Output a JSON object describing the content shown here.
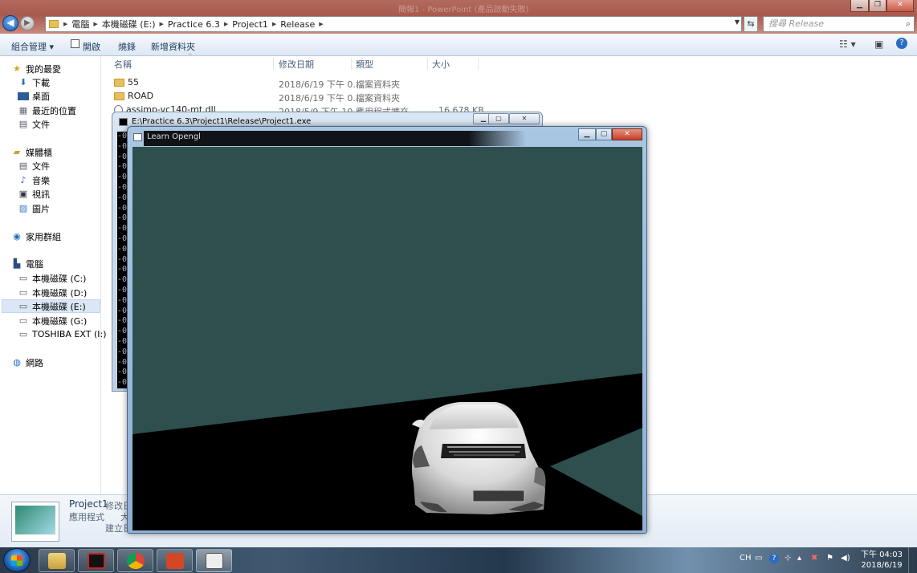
{
  "explorer": {
    "ghost_title": "簡報1 - PowerPoint (產品啟動失敗)",
    "address": [
      "電腦",
      "本機磁碟 (E:)",
      "Practice 6.3",
      "Project1",
      "Release"
    ],
    "search_placeholder": "搜尋 Release",
    "toolbar": {
      "organize": "組合管理 ▾",
      "open": "開啟",
      "burn": "燒錄",
      "new_folder": "新增資料夾"
    },
    "nav": {
      "favorites": "我的最愛",
      "downloads": "下載",
      "desktop": "桌面",
      "recent": "最近的位置",
      "docs_fav": "文件",
      "libraries": "媒體櫃",
      "lib_docs": "文件",
      "lib_music": "音樂",
      "lib_video": "視訊",
      "lib_pictures": "圖片",
      "homegroup": "家用群組",
      "computer": "電腦",
      "drive_c": "本機磁碟 (C:)",
      "drive_d": "本機磁碟 (D:)",
      "drive_e": "本機磁碟 (E:)",
      "drive_g": "本機磁碟 (G:)",
      "drive_i": "TOSHIBA EXT (I:)",
      "network": "網路"
    },
    "columns": {
      "name": "名稱",
      "date": "修改日期",
      "type": "類型",
      "size": "大小"
    },
    "files": [
      {
        "name": "55",
        "date": "2018/6/19 下午 0...",
        "type": "檔案資料夾",
        "size": ""
      },
      {
        "name": "ROAD",
        "date": "2018/6/19 下午 0...",
        "type": "檔案資料夾",
        "size": ""
      },
      {
        "name": "assimp-vc140-mt.dll",
        "date": "2018/5/9 下午 10...",
        "type": "應用程式擴充",
        "size": "16,678 KB"
      }
    ],
    "details": {
      "name": "Project1",
      "type": "應用程式",
      "modified_label": "修改日",
      "size_label": "大",
      "created_label": "建立日"
    }
  },
  "console": {
    "title": "E:\\Practice 6.3\\Project1\\Release\\Project1.exe",
    "lines": [
      "-0",
      "-0",
      "-0",
      "-0",
      "-0",
      "-0",
      "-0",
      "-0",
      "-0",
      "-0",
      "-0",
      "-0",
      "-0",
      "-0",
      "-0",
      "-0",
      "-0",
      "-0",
      "-0",
      "-0",
      "-0",
      "-0",
      "-0",
      "-0",
      "-0"
    ]
  },
  "gl_window": {
    "title": "Learn Opengl",
    "clear_color": "#2f4f4f"
  },
  "taskbar": {
    "lang": "CH",
    "time": "下午 04:03",
    "date": "2018/6/19"
  }
}
